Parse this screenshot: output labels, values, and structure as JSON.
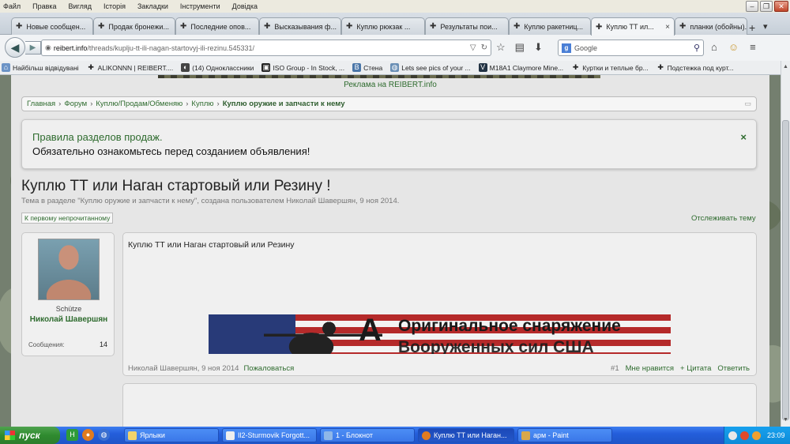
{
  "menu": [
    "Файл",
    "Правка",
    "Вигляд",
    "Історія",
    "Закладки",
    "Інструменти",
    "Довідка"
  ],
  "tabs": [
    {
      "label": "Новые сообщен...",
      "active": false
    },
    {
      "label": "Продак бронежи...",
      "active": false
    },
    {
      "label": "Последние опов...",
      "active": false
    },
    {
      "label": "Высказывания ф...",
      "active": false
    },
    {
      "label": "Куплю рюкзак ...",
      "active": false
    },
    {
      "label": "Результаты пои...",
      "active": false
    },
    {
      "label": "Куплю ракетниц...",
      "active": false
    },
    {
      "label": "Куплю ТТ ил...",
      "active": true
    },
    {
      "label": "планки (обойны)...",
      "active": false
    }
  ],
  "url": {
    "host": "reibert.info",
    "path": "/threads/kuplju-tt-ili-nagan-startovyj-ili-rezinu.545331/"
  },
  "search_placeholder": "Google",
  "bookmarks": [
    "Найбільш відвідувані",
    "ALIKONNN | REIBERT....",
    "(14) Одноклассники",
    "ISO Group - In Stock, ...",
    "Стена",
    "Lets see pics of your ...",
    "M18A1 Claymore Mine...",
    "Куртки и теплые бр...",
    "Подстежка под курт..."
  ],
  "ad_text": "Реклама на REIBERT.info",
  "breadcrumb": [
    "Главная",
    "Форум",
    "Куплю/Продам/Обменяю",
    "Куплю",
    "Куплю оружие и запчасти к нему"
  ],
  "notice": {
    "title": "Правила разделов продаж.",
    "body": "Обязательно ознакомьтесь перед созданием объявления!",
    "close": "×"
  },
  "thread": {
    "title": "Куплю ТТ или Наган стартовый или Резину !",
    "subtitle": "Тема в разделе \"Куплю оружие и запчасти к нему\", создана пользователем Николай Шавершян, 9 ноя 2014.",
    "first_unread": "К первому непрочитанному",
    "watch": "Отслеживать тему"
  },
  "user": {
    "rank": "Schütze",
    "name": "Николай Шавершян",
    "messages_label": "Сообщения:",
    "messages": "14"
  },
  "post": {
    "text": "Куплю ТТ или Наган стартовый или Резину",
    "author_date": "Николай Шавершян, 9 ноя 2014",
    "report": "Пожаловаться",
    "number": "#1",
    "like": "Мне нравится",
    "quote": "+ Цитата",
    "reply": "Ответить"
  },
  "banner": {
    "line1": "Оригинальное снаряжение",
    "line2": "Вооруженных сил США",
    "letter": "A"
  },
  "taskbar": {
    "start": "пуск",
    "buttons": [
      "Ярлыки",
      "Il2-Sturmovik Forgott...",
      "1 - Блокнот",
      "Куплю ТТ или Наган...",
      "арм - Paint"
    ],
    "clock": "23:09"
  },
  "colors": {
    "link": "#2e6b2e",
    "taskbar": "#245edb",
    "start": "#2f8b2f"
  }
}
